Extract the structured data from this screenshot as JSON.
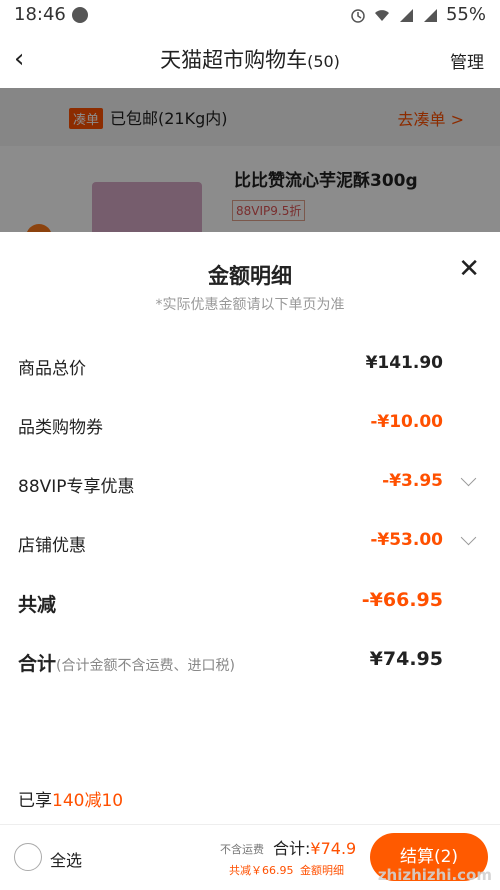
{
  "status": {
    "time": "18:46",
    "battery": "55%"
  },
  "nav": {
    "title": "天猫超市购物车",
    "count": "(50)",
    "manage": "管理"
  },
  "background": {
    "tag": "凑单",
    "shipping": "已包邮(21Kg内)",
    "go_link": "去凑单 >",
    "product_name": "比比赞流心芋泥酥300g",
    "vip_badge": "88VIP9.5折"
  },
  "sheet": {
    "title": "金额明细",
    "note": "*实际优惠金额请以下单页为准",
    "rows": [
      {
        "label": "商品总价",
        "value": "¥141.90"
      },
      {
        "label": "品类购物券",
        "value": "-¥10.00"
      },
      {
        "label": "88VIP专享优惠",
        "value": "-¥3.95"
      },
      {
        "label": "店铺优惠",
        "value": "-¥53.00"
      }
    ],
    "reduction": {
      "label": "共减",
      "value": "-¥66.95"
    },
    "total": {
      "label": "合计",
      "sub": "(合计金额不含运费、进口税)",
      "value": "¥74.95"
    },
    "promo_prefix": "已享",
    "promo_value": "140减10"
  },
  "bottom": {
    "select_all": "全选",
    "no_shipping": "不含运费",
    "total_label": "合计:",
    "total_value": "¥74.9",
    "reduced": "共减￥66.95",
    "detail_link": "金额明细",
    "settle": "结算(2)"
  },
  "watermark": "zhizhizhi.com",
  "colors": {
    "accent": "#ff5000"
  }
}
